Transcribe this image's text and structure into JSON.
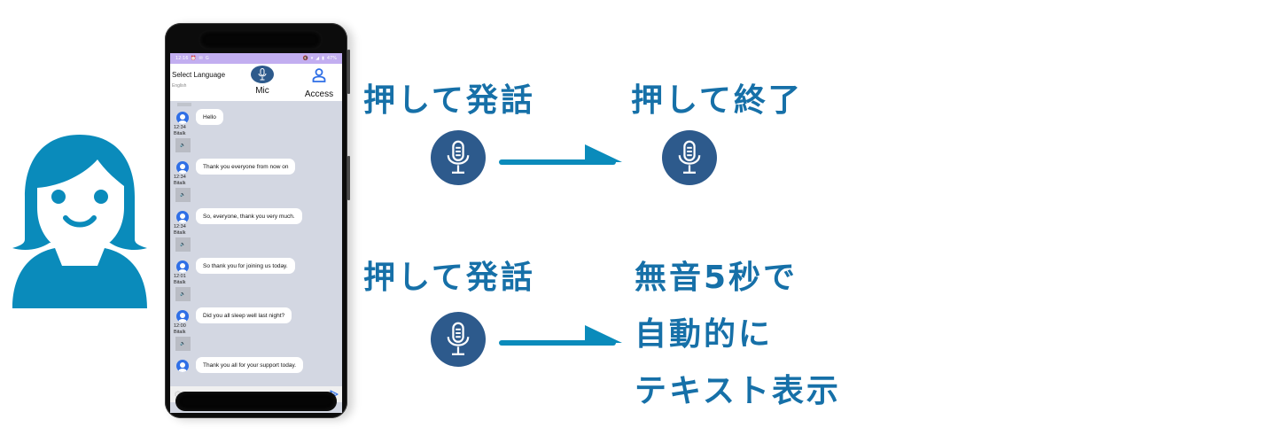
{
  "colors": {
    "accent_text": "#1670a8",
    "mic_circle": "#2d5a8c",
    "arrow": "#0a8bbb",
    "person": "#0a8bbb",
    "status_bar": "#c2aef0",
    "chat_bg": "#d3d7e2",
    "avatar": "#2f6fe6"
  },
  "person": {
    "icon": "woman-avatar-icon"
  },
  "phone": {
    "status_bar": {
      "time": "12:16",
      "left_icons": [
        "alarm-icon",
        "notification-icon",
        "google-icon"
      ],
      "right_icons": [
        "mute-icon",
        "wifi-icon",
        "signal-icon",
        "battery-icon"
      ],
      "battery": "47%"
    },
    "app_bar": {
      "language_label": "Select Language",
      "language_value": "English",
      "mic_label": "Mic",
      "access_label": "Access"
    },
    "messages": [
      {
        "time": "12:34",
        "sender": "Bitalk",
        "text": "Hello"
      },
      {
        "time": "12:34",
        "sender": "Bitalk",
        "text": "Thank you everyone from now on"
      },
      {
        "time": "12:34",
        "sender": "Bitalk",
        "text": "So, everyone, thank you very much."
      },
      {
        "time": "12:01",
        "sender": "Bitalk",
        "text": "So thank you for joining us today."
      },
      {
        "time": "12:00",
        "sender": "Bitalk",
        "text": "Did you all sleep well last night?"
      },
      {
        "time": "",
        "sender": "",
        "text": "Thank you all for your support today."
      }
    ],
    "speaker_glyph": "🔊",
    "input_bar": {
      "settings_icon": "gear-icon",
      "send_icon": "send-icon"
    }
  },
  "instructions": {
    "top": {
      "start_label": "押して発話",
      "end_label": "押して終了"
    },
    "bottom": {
      "start_label": "押して発話",
      "result_lines": [
        "無音5秒で",
        "自動的に",
        "テキスト表示"
      ]
    }
  }
}
